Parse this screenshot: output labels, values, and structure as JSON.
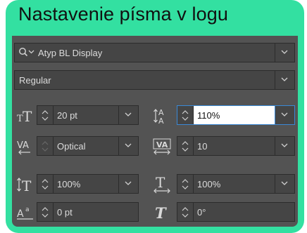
{
  "title": "Nastavenie písma v logu",
  "font_family": {
    "value": "Atyp BL Display",
    "icon": "search-icon"
  },
  "font_style": {
    "value": "Regular"
  },
  "font_size": {
    "value": "20 pt",
    "icon": "font-size-icon"
  },
  "leading": {
    "value": "110%",
    "icon": "leading-icon"
  },
  "kerning": {
    "value": "Optical",
    "icon": "kerning-icon"
  },
  "tracking": {
    "value": "10",
    "icon": "tracking-icon"
  },
  "vertical_scale": {
    "value": "100%",
    "icon": "vertical-scale-icon"
  },
  "horizontal_scale": {
    "value": "100%",
    "icon": "horizontal-scale-icon"
  },
  "baseline_shift": {
    "value": "0 pt",
    "icon": "baseline-shift-icon"
  },
  "skew": {
    "value": "0°",
    "icon": "skew-icon"
  },
  "colors": {
    "accent": "#33e0a1",
    "panel": "#535353",
    "field": "#454545",
    "focus": "#3a89d6"
  }
}
